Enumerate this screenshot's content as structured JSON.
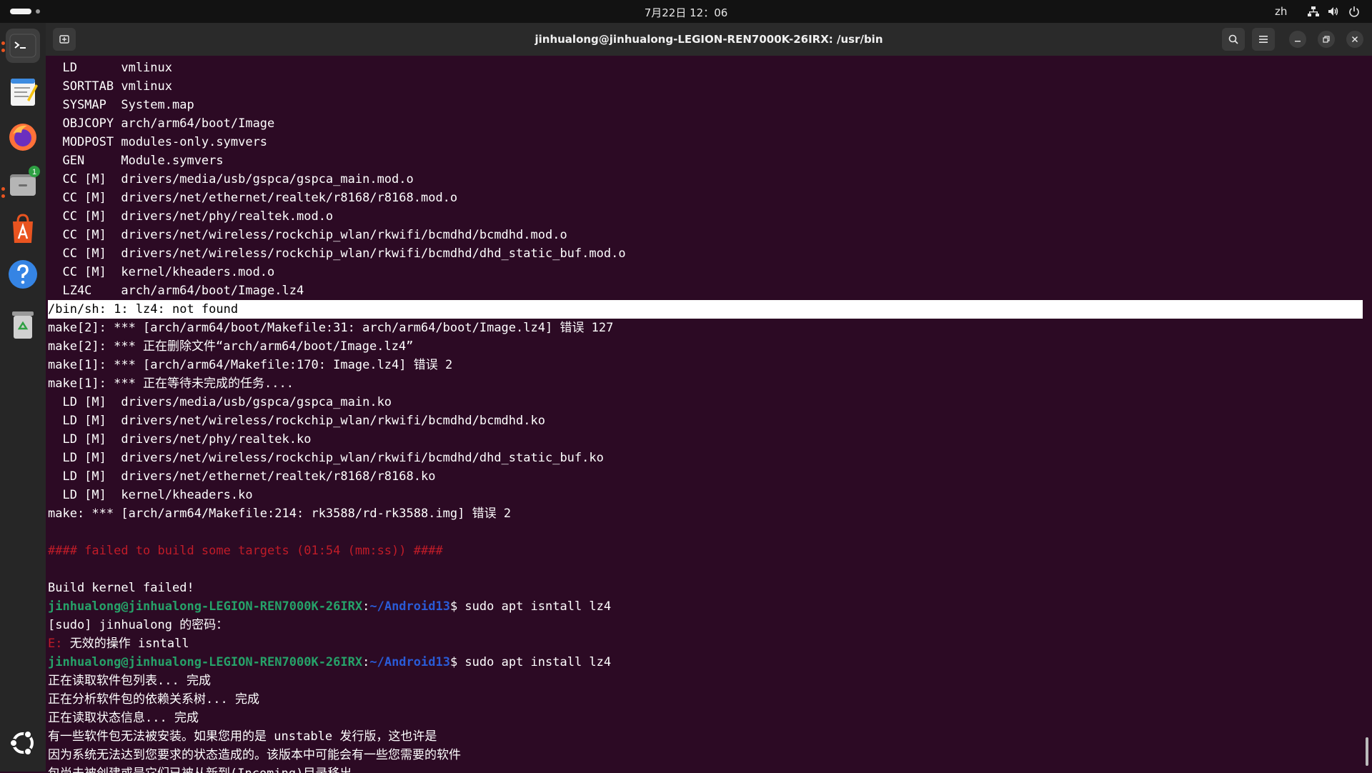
{
  "topbar": {
    "clock": "7月22日  12：06",
    "lang": "zh"
  },
  "window": {
    "title": "jinhualong@jinhualong-LEGION-REN7000K-26IRX: /usr/bin"
  },
  "dock": {
    "items": [
      "terminal-icon",
      "text-editor-icon",
      "firefox-icon",
      "files-icon",
      "app-center-icon",
      "help-icon",
      "trash-icon"
    ],
    "files_badge": "1"
  },
  "prompt": {
    "user": "jinhualong@jinhualong-LEGION-REN7000K-26IRX",
    "path": "~/Android13"
  },
  "terminal": {
    "lines": [
      "  LD      vmlinux",
      "  SORTTAB vmlinux",
      "  SYSMAP  System.map",
      "  OBJCOPY arch/arm64/boot/Image",
      "  MODPOST modules-only.symvers",
      "  GEN     Module.symvers",
      "  CC [M]  drivers/media/usb/gspca/gspca_main.mod.o",
      "  CC [M]  drivers/net/ethernet/realtek/r8168/r8168.mod.o",
      "  CC [M]  drivers/net/phy/realtek.mod.o",
      "  CC [M]  drivers/net/wireless/rockchip_wlan/rkwifi/bcmdhd/bcmdhd.mod.o",
      "  CC [M]  drivers/net/wireless/rockchip_wlan/rkwifi/bcmdhd/dhd_static_buf.mod.o",
      "  CC [M]  kernel/kheaders.mod.o",
      "  LZ4C    arch/arm64/boot/Image.lz4",
      "/bin/sh: 1: lz4: not found",
      "make[2]: *** [arch/arm64/boot/Makefile:31: arch/arm64/boot/Image.lz4] 错误 127",
      "make[2]: *** 正在删除文件“arch/arm64/boot/Image.lz4”",
      "make[1]: *** [arch/arm64/Makefile:170: Image.lz4] 错误 2",
      "make[1]: *** 正在等待未完成的任务....",
      "  LD [M]  drivers/media/usb/gspca/gspca_main.ko",
      "  LD [M]  drivers/net/wireless/rockchip_wlan/rkwifi/bcmdhd/bcmdhd.ko",
      "  LD [M]  drivers/net/phy/realtek.ko",
      "  LD [M]  drivers/net/wireless/rockchip_wlan/rkwifi/bcmdhd/dhd_static_buf.ko",
      "  LD [M]  drivers/net/ethernet/realtek/r8168/r8168.ko",
      "  LD [M]  kernel/kheaders.ko",
      "make: *** [arch/arm64/Makefile:214: rk3588/rd-rk3588.img] 错误 2",
      "",
      "#### failed to build some targets (01:54 (mm:ss)) ####",
      "",
      "Build kernel failed!",
      "$ sudo apt isntall lz4",
      "[sudo] jinhualong 的密码：",
      "E: 无效的操作 isntall",
      "$ sudo apt install lz4",
      "正在读取软件包列表... 完成",
      "正在分析软件包的依赖关系树... 完成",
      "正在读取状态信息... 完成",
      "有一些软件包无法被安装。如果您用的是 unstable 发行版，这也许是",
      "因为系统无法达到您要求的状态造成的。该版本中可能会有一些您需要的软件",
      "包尚未被创建或是它们已被从新到(Incoming)目录移出。"
    ]
  },
  "colors": {
    "terminal_bg": "#2c0a24",
    "prompt_user": "#26a269",
    "prompt_path": "#2a5bd7",
    "error_red": "#c01c28"
  }
}
